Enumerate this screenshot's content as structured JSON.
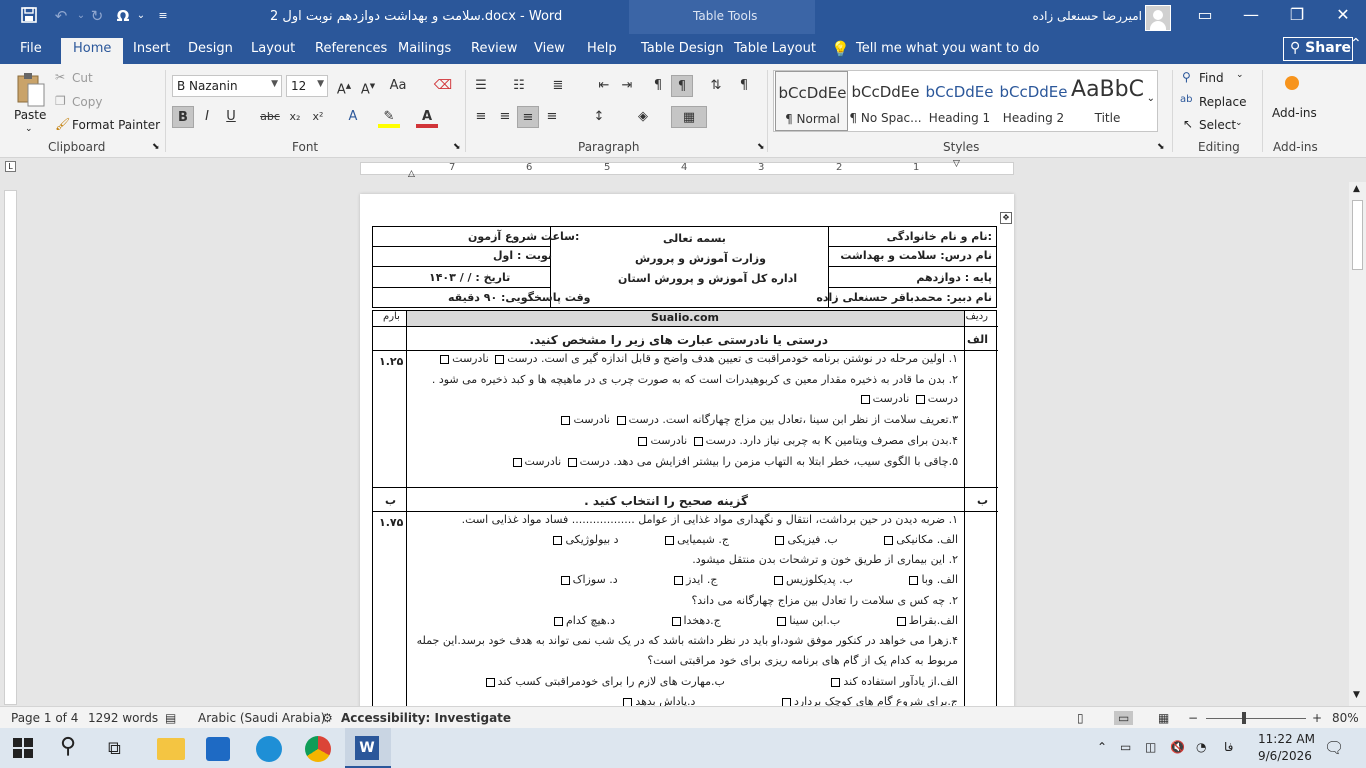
{
  "titlebar": {
    "doc_title": "سلامت و بهداشت دوازدهم نوبت اول 2.docx - Word",
    "table_tools": "Table Tools",
    "user": "امیررضا حسنعلی زاده",
    "save_icon": "save-icon",
    "undo_icon": "undo-icon",
    "redo_icon": "redo-icon",
    "symbol_icon": "omega-icon"
  },
  "tabs": [
    "File",
    "Home",
    "Insert",
    "Design",
    "Layout",
    "References",
    "Mailings",
    "Review",
    "View",
    "Help",
    "Table Design",
    "Table Layout"
  ],
  "active_tab": "Home",
  "tellme": "Tell me what you want to do",
  "share": "Share",
  "ribbon": {
    "clipboard": {
      "label": "Clipboard",
      "paste": "Paste",
      "cut": "Cut",
      "copy": "Copy",
      "format_painter": "Format Painter"
    },
    "font": {
      "label": "Font",
      "family": "B Nazanin",
      "size": "12"
    },
    "paragraph": {
      "label": "Paragraph"
    },
    "styles": {
      "label": "Styles",
      "items": [
        {
          "preview": "bCcDdEe",
          "name": "¶ Normal"
        },
        {
          "preview": "bCcDdEe",
          "name": "¶ No Spac..."
        },
        {
          "preview": "bCcDdEe",
          "name": "Heading 1"
        },
        {
          "preview": "bCcDdEe",
          "name": "Heading 2"
        },
        {
          "preview": "AaBbC",
          "name": "Title"
        }
      ]
    },
    "editing": {
      "label": "Editing",
      "find": "Find",
      "replace": "Replace",
      "select": "Select"
    },
    "addins": {
      "label": "Add-ins",
      "button": "Add-ins"
    }
  },
  "ruler_numbers": [
    "7",
    "6",
    "5",
    "4",
    "3",
    "2",
    "1"
  ],
  "document": {
    "header": {
      "name_label": "نام و نام خانوادگی:",
      "course": "نام درس: سلامت و بهداشت",
      "grade": "پایه : دوازدهم",
      "teacher": "نام دبیر: محمدباقر حسنعلی زاده",
      "bismillah": "بسمه تعالی",
      "ministry": "وزارت آموزش و پرورش",
      "office": "اداره کل آموزش و پرورش استان",
      "start_time": "ساعت شروع آزمون:",
      "session": "نوبت   :  اول",
      "date": "تاریخ  :    /   /   ۱۴۰۳",
      "duration": "وقت پاسخگویی: ۹۰ دقیقه"
    },
    "col_row": "ردیف",
    "col_site": "Sualio.com",
    "col_score": "بارم",
    "section_a": {
      "letter": "الف",
      "title": "درستی یا نادرستی عبارت های زیر را مشخص کنید.",
      "score": "۱.۲۵",
      "lines": [
        "۱. اولین مرحله در نوشتن برنامه خودمراقبت ی تعیین هدف واضح و قابل اندازه گیر ی است. درست",
        "۲. بدن ما قادر به ذخیره مقدار معین  ی کربوهیدرات است که به صورت چرب ی در ماهیچه ها و کبد ذخیره می شود .",
        "درست",
        "۳.تعریف سلامت از نظر ابن سینا ،تعادل بین مزاج چهارگانه است. درست",
        "۴.بدن برای مصرف ویتامین K به چربی نیاز دارد. درست",
        "۵.چاقی با الگوی سیب، خطر ابتلا به التهاب مزمن را بیشتر افزایش می دهد. درست"
      ],
      "false_word": "نادرست"
    },
    "section_b": {
      "letter": "ب",
      "title": "گزینه صحیح را انتخاب کنید .",
      "score": "۱.۷۵",
      "lines": [
        "۱. ضربه دیدن در حین برداشت، انتقال و نگهداری مواد غذایی از عوامل .................. فساد مواد غذایی است.",
        "الف. مکانیکی",
        "ب. فیزیکی",
        "ج. شیمیایی",
        "د بیولوژیکی",
        "۲. این بیماری از طریق خون و ترشحات بدن منتقل میشود.",
        "الف. وبا",
        "ب. پدیکلوزیس",
        "ج. ایدز",
        "د. سوزاک",
        "۲. چه کس  ی سلامت را تعادل بین مزاج چهارگانه می داند؟",
        "الف.بقراط",
        "ب.ابن سینا",
        "ج.دهخدا",
        "د.هیچ کدام",
        "۴.زهرا می خواهد در کنکور موفق شود،او باید  در نظر داشته باشد که در یک شب نمی تواند به هدف خود برسد.این جمله",
        "مربوط به کدام یک از گام های برنامه ریزی برای خود مراقبتی است؟",
        "الف.از یادآور استفاده کند",
        "ب.مهارت های لازم را برای خودمراقبتی کسب کند",
        "ج.برای شروع گام های کوچک بردارد",
        "د.پاداش بدهد"
      ]
    }
  },
  "status": {
    "page": "Page 1 of 4",
    "words": "1292 words",
    "language": "Arabic (Saudi Arabia)",
    "accessibility": "Accessibility: Investigate",
    "zoom": "80%"
  },
  "taskbar": {
    "time": "11:22 AM",
    "date": "9/6/2026",
    "lang": "فا"
  }
}
